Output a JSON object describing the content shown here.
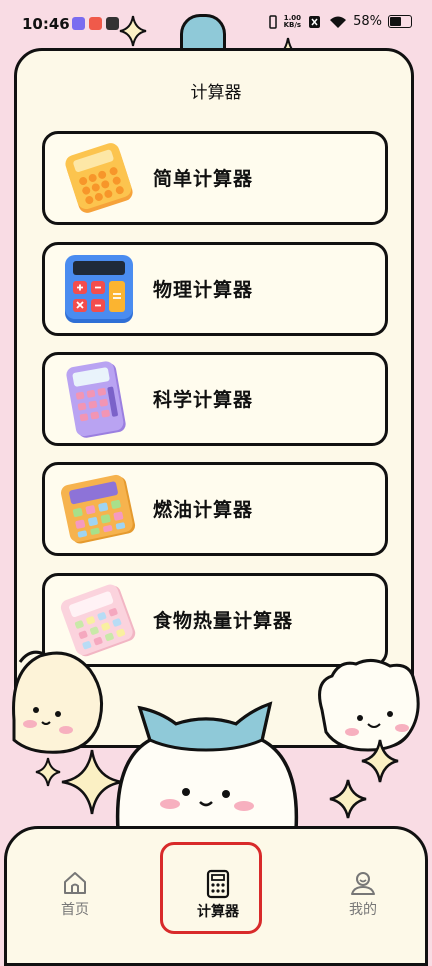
{
  "status_bar": {
    "time": "10:46",
    "net_speed_value": "1.00",
    "net_speed_unit": "KB/s",
    "battery": "58%"
  },
  "page": {
    "title": "计算器"
  },
  "calculators": [
    {
      "label": "简单计算器",
      "icon": "simple-calculator-icon"
    },
    {
      "label": "物理计算器",
      "icon": "physics-calculator-icon"
    },
    {
      "label": "科学计算器",
      "icon": "scientific-calculator-icon"
    },
    {
      "label": "燃油计算器",
      "icon": "fuel-calculator-icon"
    },
    {
      "label": "食物热量计算器",
      "icon": "food-calorie-calculator-icon"
    }
  ],
  "bottom_nav": {
    "items": [
      {
        "label": "首页",
        "icon": "home-icon"
      },
      {
        "label": "计算器",
        "icon": "calculator-icon",
        "active": true
      },
      {
        "label": "我的",
        "icon": "profile-icon"
      }
    ]
  },
  "colors": {
    "background": "#f9dce4",
    "panel": "#fdf9e8",
    "outline": "#111111",
    "highlight": "#d82a2a",
    "character_hat": "#8fc9d8"
  }
}
